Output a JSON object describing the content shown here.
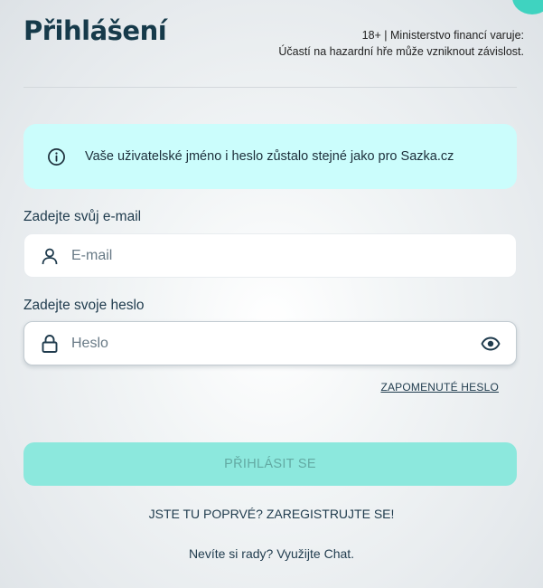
{
  "header": {
    "title": "Přihlášení",
    "warning_line1": "18+ | Ministerstvo financí varuje:",
    "warning_line2": "Účastí na hazardní hře může vzniknout závislost."
  },
  "info": {
    "text": "Vaše uživatelské jméno i heslo zůstalo stejné jako pro Sazka.cz",
    "icon": "info-icon"
  },
  "email": {
    "label": "Zadejte svůj e-mail",
    "placeholder": "E-mail",
    "value": "",
    "icon": "user-icon"
  },
  "password": {
    "label": "Zadejte svoje heslo",
    "placeholder": "Heslo",
    "value": "",
    "icon": "lock-icon",
    "toggle_icon": "eye-icon"
  },
  "forgot_password": "ZAPOMENUTÉ HESLO",
  "login_button": "PŘIHLÁSIT SE",
  "register": {
    "prompt": "JSTE TU POPRVÉ?",
    "link": "ZAREGISTRUJTE SE!"
  },
  "help": {
    "prompt": "Nevíte si rady? Využijte",
    "link": "Chat."
  },
  "colors": {
    "accent": "#3fd3c0",
    "info_bg": "#cbfdfc",
    "button_bg": "#8ce8dd",
    "button_text": "#63aaa3",
    "text_primary": "#1f3b4d"
  }
}
